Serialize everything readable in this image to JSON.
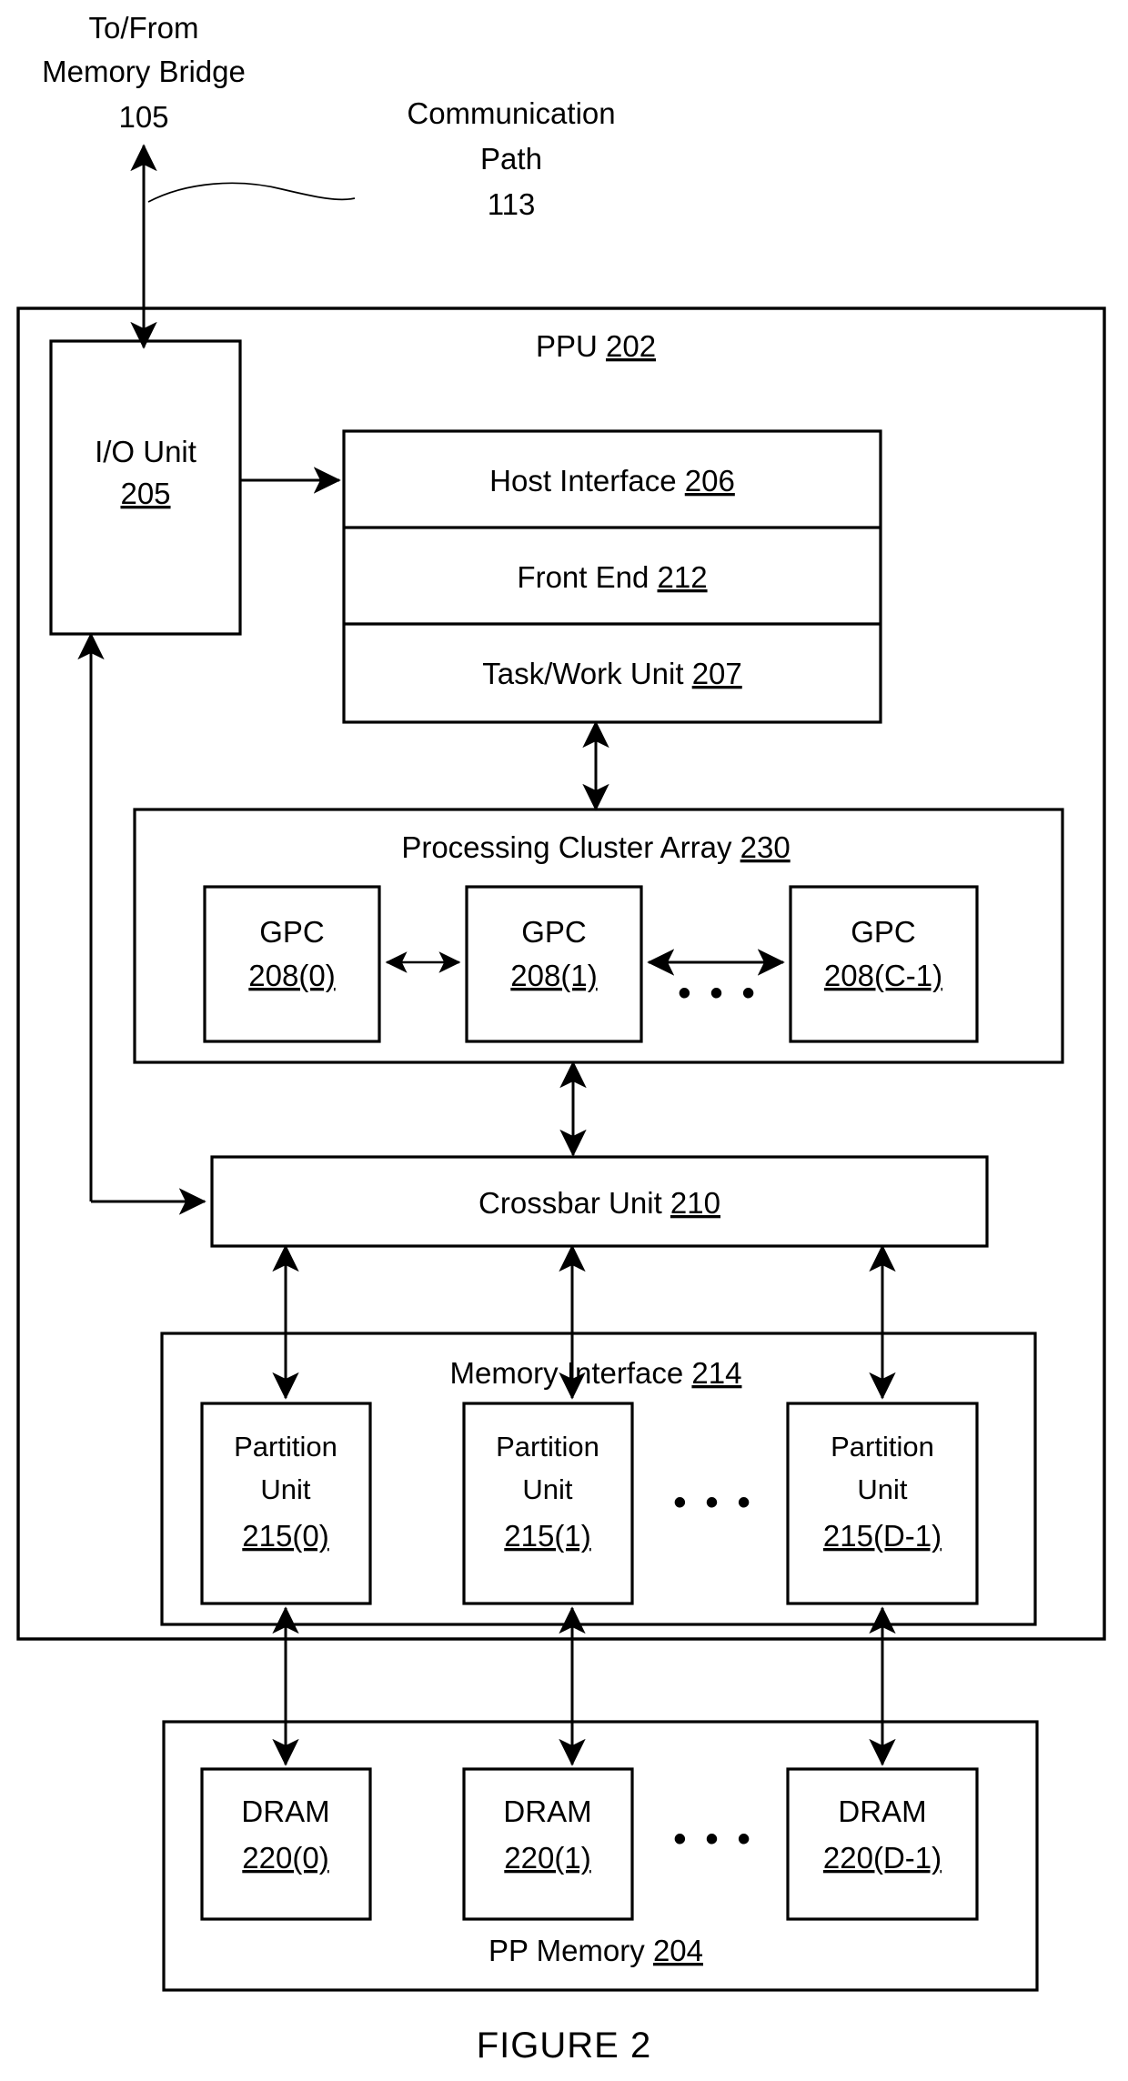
{
  "figure": {
    "caption": "FIGURE 2"
  },
  "annotations": {
    "memory_bridge": {
      "line1": "To/From",
      "line2": "Memory Bridge",
      "ref": "105"
    },
    "communication_path": {
      "line1": "Communication",
      "line2": "Path",
      "ref": "113"
    }
  },
  "ppu": {
    "title": "PPU",
    "ref": "202",
    "io_unit": {
      "line1": "I/O Unit",
      "ref": "205"
    },
    "interface_stack": [
      {
        "label": "Host Interface",
        "ref": "206"
      },
      {
        "label": "Front End",
        "ref": "212"
      },
      {
        "label": "Task/Work Unit",
        "ref": "207"
      }
    ],
    "processing_cluster_array": {
      "title": "Processing Cluster Array",
      "ref": "230",
      "gpcs": [
        {
          "label": "GPC",
          "ref": "208(0)"
        },
        {
          "label": "GPC",
          "ref": "208(1)"
        },
        {
          "label": "GPC",
          "ref": "208(C-1)"
        }
      ],
      "ellipsis": "• • •"
    },
    "crossbar_unit": {
      "label": "Crossbar Unit",
      "ref": "210"
    },
    "memory_interface": {
      "title": "Memory Interface",
      "ref": "214",
      "partition_units": [
        {
          "line1": "Partition",
          "line2": "Unit",
          "ref": "215(0)"
        },
        {
          "line1": "Partition",
          "line2": "Unit",
          "ref": "215(1)"
        },
        {
          "line1": "Partition",
          "line2": "Unit",
          "ref": "215(D-1)"
        }
      ],
      "ellipsis": "• • •"
    }
  },
  "pp_memory": {
    "title": "PP Memory",
    "ref": "204",
    "drams": [
      {
        "label": "DRAM",
        "ref": "220(0)"
      },
      {
        "label": "DRAM",
        "ref": "220(1)"
      },
      {
        "label": "DRAM",
        "ref": "220(D-1)"
      }
    ],
    "ellipsis": "• • •"
  },
  "colors": {
    "ink": "#000000",
    "paper": "#ffffff"
  }
}
